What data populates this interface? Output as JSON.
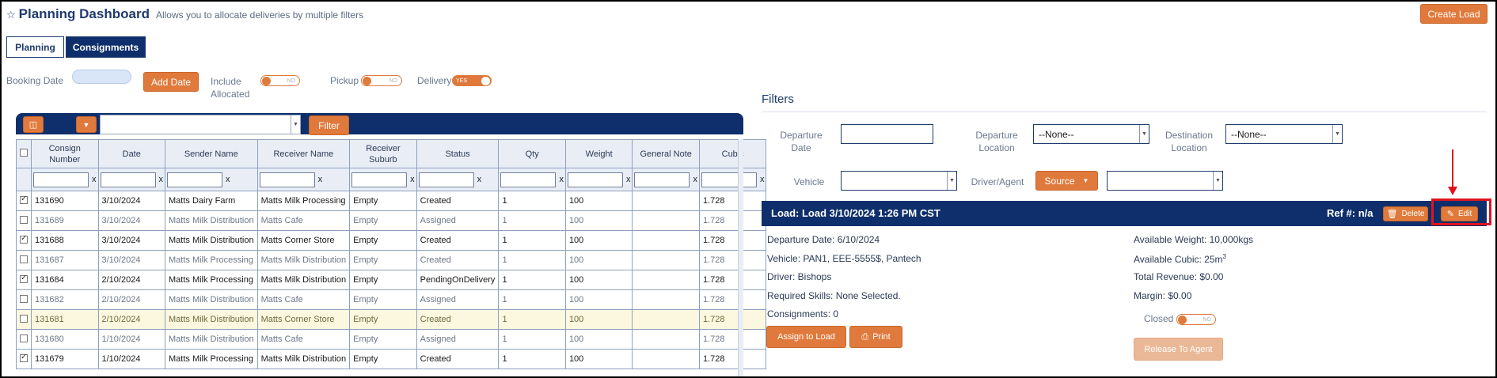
{
  "header": {
    "title": "Planning Dashboard",
    "subtitle": "Allows you to allocate deliveries by multiple filters",
    "create_load_label": "Create Load"
  },
  "tabs": [
    {
      "label": "Planning",
      "active": false
    },
    {
      "label": "Consignments",
      "active": true
    }
  ],
  "top_filters": {
    "booking_date_label": "Booking Date",
    "add_date_label": "Add Date",
    "include_allocated_label": "Include Allocated",
    "include_allocated_value": "NO",
    "pickup_label": "Pickup",
    "pickup_value": "NO",
    "delivery_label": "Delivery",
    "delivery_value": "YES"
  },
  "grid": {
    "filter_button_label": "Filter",
    "columns": [
      "Consign Number",
      "Date",
      "Sender Name",
      "Receiver Name",
      "Receiver Suburb",
      "Status",
      "Qty",
      "Weight",
      "General Note",
      "Cubic"
    ],
    "filter_clear_symbol": "x",
    "rows": [
      {
        "checked": true,
        "style": "dark",
        "consign": "131690",
        "date": "3/10/2024",
        "sender": "Matts Dairy Farm",
        "receiver": "Matts Milk Processing",
        "suburb": "Empty",
        "status": "Created",
        "qty": "1",
        "weight": "100",
        "note": "",
        "cubic": "1.728"
      },
      {
        "checked": false,
        "style": "muted",
        "consign": "131689",
        "date": "3/10/2024",
        "sender": "Matts Milk Distribution",
        "receiver": "Matts Cafe",
        "suburb": "Empty",
        "status": "Assigned",
        "qty": "1",
        "weight": "100",
        "note": "",
        "cubic": "1.728"
      },
      {
        "checked": true,
        "style": "dark",
        "consign": "131688",
        "date": "3/10/2024",
        "sender": "Matts Milk Distribution",
        "receiver": "Matts Corner Store",
        "suburb": "Empty",
        "status": "Created",
        "qty": "1",
        "weight": "100",
        "note": "",
        "cubic": "1.728"
      },
      {
        "checked": false,
        "style": "muted",
        "consign": "131687",
        "date": "3/10/2024",
        "sender": "Matts Milk Processing",
        "receiver": "Matts Milk Distribution",
        "suburb": "Empty",
        "status": "Created",
        "qty": "1",
        "weight": "100",
        "note": "",
        "cubic": "1.728"
      },
      {
        "checked": true,
        "style": "dark",
        "consign": "131684",
        "date": "2/10/2024",
        "sender": "Matts Milk Processing",
        "receiver": "Matts Milk Distribution",
        "suburb": "Empty",
        "status": "PendingOnDelivery",
        "qty": "1",
        "weight": "100",
        "note": "",
        "cubic": "1.728"
      },
      {
        "checked": false,
        "style": "muted",
        "consign": "131682",
        "date": "2/10/2024",
        "sender": "Matts Milk Distribution",
        "receiver": "Matts Cafe",
        "suburb": "Empty",
        "status": "Assigned",
        "qty": "1",
        "weight": "100",
        "note": "",
        "cubic": "1.728"
      },
      {
        "checked": false,
        "style": "highlight",
        "consign": "131681",
        "date": "2/10/2024",
        "sender": "Matts Milk Distribution",
        "receiver": "Matts Corner Store",
        "suburb": "Empty",
        "status": "Created",
        "qty": "1",
        "weight": "100",
        "note": "",
        "cubic": "1.728"
      },
      {
        "checked": false,
        "style": "muted",
        "consign": "131680",
        "date": "1/10/2024",
        "sender": "Matts Milk Distribution",
        "receiver": "Matts Cafe",
        "suburb": "Empty",
        "status": "Assigned",
        "qty": "1",
        "weight": "100",
        "note": "",
        "cubic": "1.728"
      },
      {
        "checked": true,
        "style": "dark",
        "consign": "131679",
        "date": "1/10/2024",
        "sender": "Matts Milk Processing",
        "receiver": "Matts Milk Distribution",
        "suburb": "Empty",
        "status": "Created",
        "qty": "1",
        "weight": "100",
        "note": "",
        "cubic": "1.728"
      }
    ]
  },
  "filters_panel": {
    "title": "Filters",
    "departure_date_label": "Departure Date",
    "departure_location_label": "Departure Location",
    "departure_location_value": "--None--",
    "destination_location_label": "Destination Location",
    "destination_location_value": "--None--",
    "vehicle_label": "Vehicle",
    "driver_agent_label": "Driver/Agent",
    "source_label": "Source"
  },
  "load": {
    "title": "Load: Load 3/10/2024 1:26 PM CST",
    "ref": "Ref #: n/a",
    "delete_label": "Delete",
    "edit_label": "Edit",
    "departure_date": "Departure Date: 6/10/2024",
    "vehicle": "Vehicle: PAN1, EEE-5555$, Pantech",
    "driver": "Driver: Bishops",
    "required_skills": "Required Skills: None Selected.",
    "consignments": "Consignments: 0",
    "available_weight": "Available Weight: 10,000kgs",
    "available_cubic": "Available Cubic: 25m",
    "available_cubic_sup": "3",
    "total_revenue": "Total Revenue: $0.00",
    "margin": "Margin: $0.00",
    "closed_label": "Closed",
    "closed_value": "NO",
    "assign_label": "Assign to Load",
    "print_label": "Print",
    "release_label": "Release To Agent"
  },
  "colors": {
    "navy": "#0e2f6b",
    "orange": "#e07a3c",
    "highlight": "#e0141e"
  }
}
